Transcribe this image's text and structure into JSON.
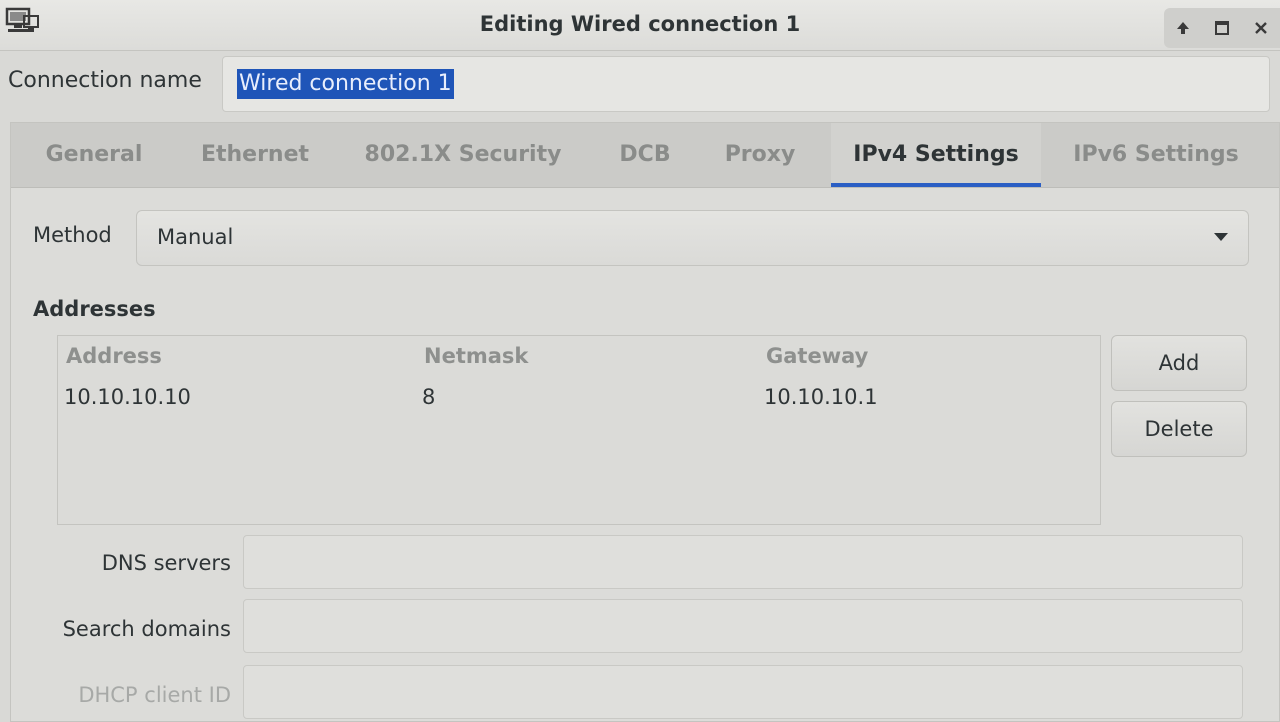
{
  "window": {
    "title": "Editing Wired connection 1",
    "icon": "network-computer-icon",
    "controls": [
      "up-arrow-icon",
      "maximize-icon",
      "close-icon"
    ]
  },
  "connection": {
    "label": "Connection name",
    "value": "Wired connection 1"
  },
  "tabs": [
    {
      "label": "General"
    },
    {
      "label": "Ethernet"
    },
    {
      "label": "802.1X Security"
    },
    {
      "label": "DCB"
    },
    {
      "label": "Proxy"
    },
    {
      "label": "IPv4 Settings",
      "active": true
    },
    {
      "label": "IPv6 Settings"
    }
  ],
  "method": {
    "label": "Method",
    "value": "Manual"
  },
  "addresses": {
    "heading": "Addresses",
    "columns": [
      "Address",
      "Netmask",
      "Gateway"
    ],
    "rows": [
      [
        "10.10.10.10",
        "8",
        "10.10.10.1"
      ]
    ],
    "add_label": "Add",
    "delete_label": "Delete"
  },
  "fields": {
    "dns_label": "DNS servers",
    "dns_value": "",
    "search_label": "Search domains",
    "search_value": "",
    "dhcp_label": "DHCP client ID"
  },
  "colors": {
    "accent": "#2a5ec4",
    "selection": "#1f55b8"
  }
}
